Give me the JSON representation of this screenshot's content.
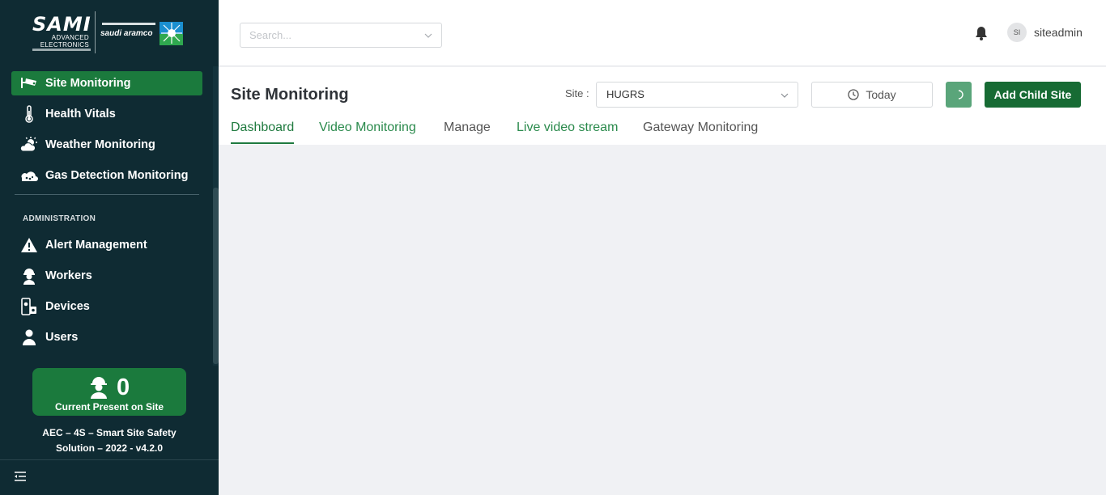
{
  "brand": {
    "sami_word": "SAMI",
    "sami_sub1": "ADVANCED",
    "sami_sub2": "ELECTRONICS",
    "aramco_text": "saudi aramco"
  },
  "sidebar": {
    "items": [
      {
        "label": "Site Monitoring",
        "icon": "cctv-camera-icon",
        "active": true
      },
      {
        "label": "Health Vitals",
        "icon": "thermometer-icon"
      },
      {
        "label": "Weather Monitoring",
        "icon": "sun-cloud-icon"
      },
      {
        "label": "Gas Detection Monitoring",
        "icon": "gas-cloud-icon"
      }
    ],
    "section_label": "ADMINISTRATION",
    "admin_items": [
      {
        "label": "Alert Management",
        "icon": "warning-icon"
      },
      {
        "label": "Workers",
        "icon": "worker-helmet-icon"
      },
      {
        "label": "Devices",
        "icon": "devices-icon"
      },
      {
        "label": "Users",
        "icon": "user-icon"
      }
    ],
    "present": {
      "count": "0",
      "label": "Current Present on Site"
    },
    "version_line1": "AEC – 4S – Smart Site Safety",
    "version_line2": "Solution – 2022 - v4.2.0"
  },
  "header": {
    "search_placeholder": "Search...",
    "avatar_initials": "SI",
    "username": "siteadmin"
  },
  "main": {
    "title": "Site Monitoring",
    "site_label": "Site :",
    "site_value": "HUGRS",
    "date_label": "Today",
    "add_button": "Add Child Site",
    "tabs": [
      {
        "label": "Dashboard",
        "state": "active"
      },
      {
        "label": "Video Monitoring",
        "state": "green"
      },
      {
        "label": "Manage",
        "state": "grey"
      },
      {
        "label": "Live video stream",
        "state": "green"
      },
      {
        "label": "Gateway Monitoring",
        "state": "grey"
      }
    ]
  },
  "colors": {
    "sidebar_bg": "#0f2b33",
    "accent_green": "#1b7a3d",
    "button_green": "#176b34",
    "content_bg": "#f0f1f4"
  }
}
